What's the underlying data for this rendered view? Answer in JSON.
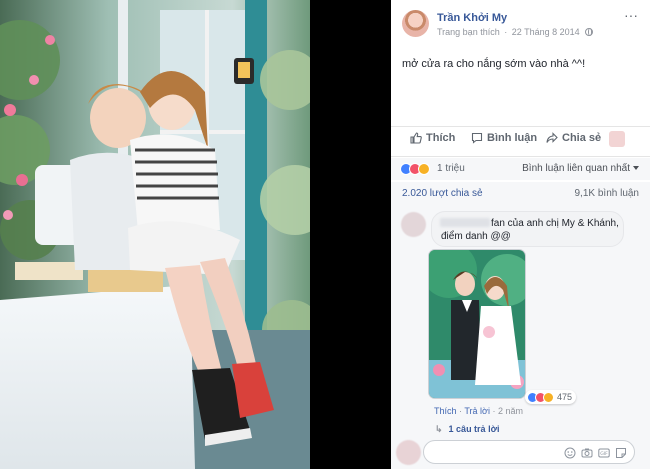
{
  "post": {
    "author": "Trần Khởi My",
    "meta_source": "Trang bạn thích",
    "meta_separator": "·",
    "meta_date": "22 Tháng 8 2014",
    "more_icon": "ellipsis-icon",
    "more_label": "···",
    "caption": "mở cửa ra cho nắng sớm vào nhà ^^!"
  },
  "actions": {
    "like_label": "Thích",
    "comment_label": "Bình luận",
    "share_label": "Chia sẻ"
  },
  "reactions": {
    "count": "1 triệu",
    "sort_label": "Bình luận liên quan nhất",
    "types": [
      "like",
      "love",
      "wow"
    ]
  },
  "stats": {
    "shares": "2.020 lượt chia sẻ",
    "comments": "9,1K bình luận"
  },
  "comment": {
    "text_line1": "fan của anh chị My & Khánh,",
    "text_line2": "điểm danh @@",
    "reactions_count": "475",
    "like_link": "Thích",
    "separator": "·",
    "reply_link": "Trả lời",
    "age": "2 năm",
    "replies_label": "1 câu trả lời"
  },
  "composer": {
    "placeholder": "",
    "icons": [
      "emoji-icon",
      "camera-icon",
      "gif-icon",
      "sticker-icon"
    ]
  },
  "colors": {
    "link_blue": "#385898",
    "muted": "#90949c",
    "like_blue": "#4080ff",
    "love_red": "#f25268",
    "wow_yellow": "#f7b125",
    "panel_bg": "#f6f7f9"
  }
}
